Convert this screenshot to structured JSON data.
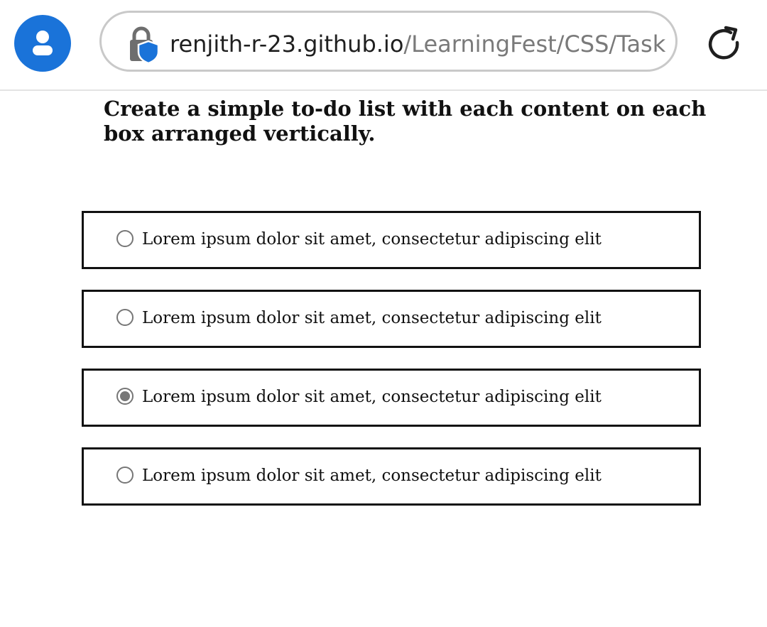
{
  "browser": {
    "url_domain": "renjith-r-23.github.io",
    "url_path": "/LearningFest/CSS/Task",
    "icons": {
      "profile": "user-avatar-icon",
      "security": "lock-shield-icon",
      "reload": "reload-icon"
    },
    "accent_color": "#1a73d9"
  },
  "page": {
    "title": "Create a simple to-do list with each content on each box arranged vertically.",
    "todos": [
      {
        "label": "Lorem ipsum dolor sit amet, consectetur adipiscing elit",
        "checked": false
      },
      {
        "label": "Lorem ipsum dolor sit amet, consectetur adipiscing elit",
        "checked": false
      },
      {
        "label": "Lorem ipsum dolor sit amet, consectetur adipiscing elit",
        "checked": true
      },
      {
        "label": "Lorem ipsum dolor sit amet, consectetur adipiscing elit",
        "checked": false
      }
    ]
  }
}
